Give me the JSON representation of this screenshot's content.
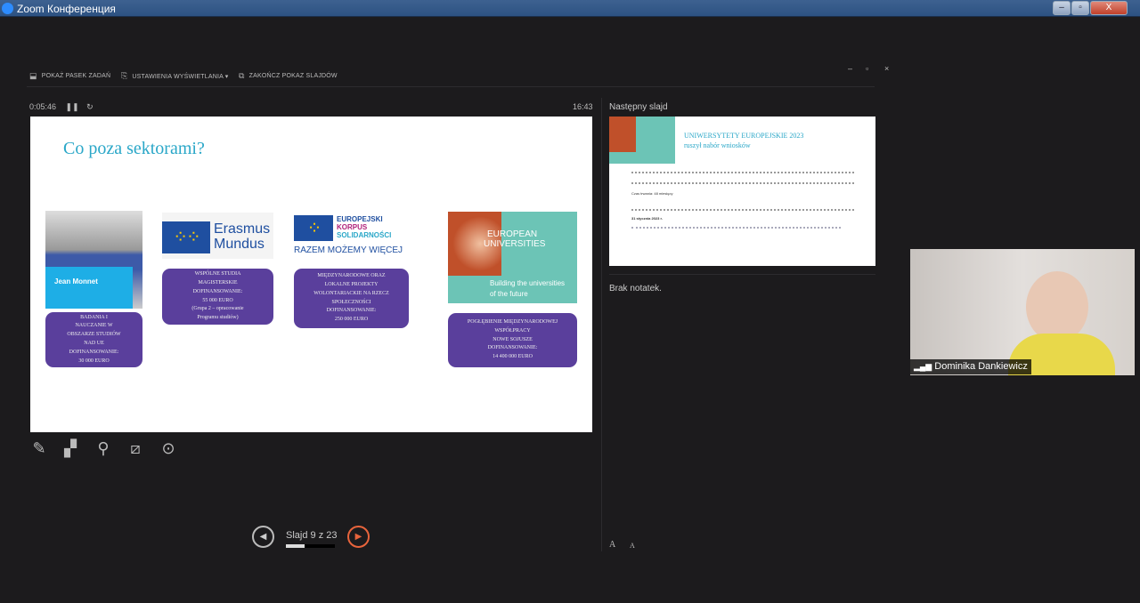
{
  "window": {
    "title": "Zoom Конференция",
    "minimize": "–",
    "restore": "▫",
    "close": "X"
  },
  "toolbar": {
    "show_taskbar": "POKAŻ PASEK ZADAŃ",
    "display_settings": "USTAWIENIA WYŚWIETLANIA ▾",
    "end_show": "ZAKOŃCZ POKAZ SLAJDÓW"
  },
  "window_controls": {
    "min": "–",
    "max": "▫",
    "close": "×"
  },
  "timer": {
    "elapsed": "0:05:46",
    "clock": "16:43"
  },
  "slide": {
    "title": "Co poza sektorami?",
    "jean_monnet": "Jean Monnet",
    "erasmus": [
      "Erasmus",
      "Mundus"
    ],
    "corps": [
      "EUROPEJSKI",
      "KORPUS",
      "SOLIDARNOŚCI",
      "RAZEM MOŻEMY WIĘCEJ"
    ],
    "eu_univ": [
      "EUROPEAN",
      "UNIVERSITIES",
      "Building the universities",
      "of the future"
    ],
    "cards": [
      [
        "BADANIA I",
        "NAUCZANIE W",
        "OBSZARZE STUDIÓW",
        "NAD UE",
        "DOFINANSOWANIE:",
        "30 000 EURO"
      ],
      [
        "WSPÓLNE STUDIA",
        "MAGISTERSKIE",
        "DOFINANSOWANIE:",
        "55 000 EURO",
        "(Grupa 2 – opracowanie",
        "Programu studiów)"
      ],
      [
        "MIĘDZYNARODOWE ORAZ",
        "LOKALNE PROJEKTY",
        "WOLONTARIACKIE NA RZECZ",
        "SPOŁECZNOŚCI",
        "DOFINANSOWANIE:",
        "250 000 EURO"
      ],
      [
        "POGŁĘBIENIE MIĘDZYNARODOWEJ",
        "WSPÓŁPRACY",
        "NOWE SOJUSZE",
        "DOFINANSOWANIE:",
        "14 400 000 EURO"
      ]
    ]
  },
  "next_slide": {
    "label": "Następny slajd",
    "title": "UNIWERSYTETY EUROPEJSKIE 2023",
    "subtitle": "ruszył nabór wniosków",
    "duration": "Czas trwania: 48 miesięcy",
    "deadline": "31 stycznia 2023 r."
  },
  "notes": {
    "text": "Brak notatek.",
    "font_up": "A",
    "font_down": "A"
  },
  "navigation": {
    "slide_counter": "Slajd 9 z 23",
    "progress": 0.39
  },
  "video": {
    "participant": "Dominika Dankiewicz"
  },
  "colors": {
    "card": "#5a3f9c",
    "title": "#2aa7c8",
    "accent": "#e8643c"
  }
}
